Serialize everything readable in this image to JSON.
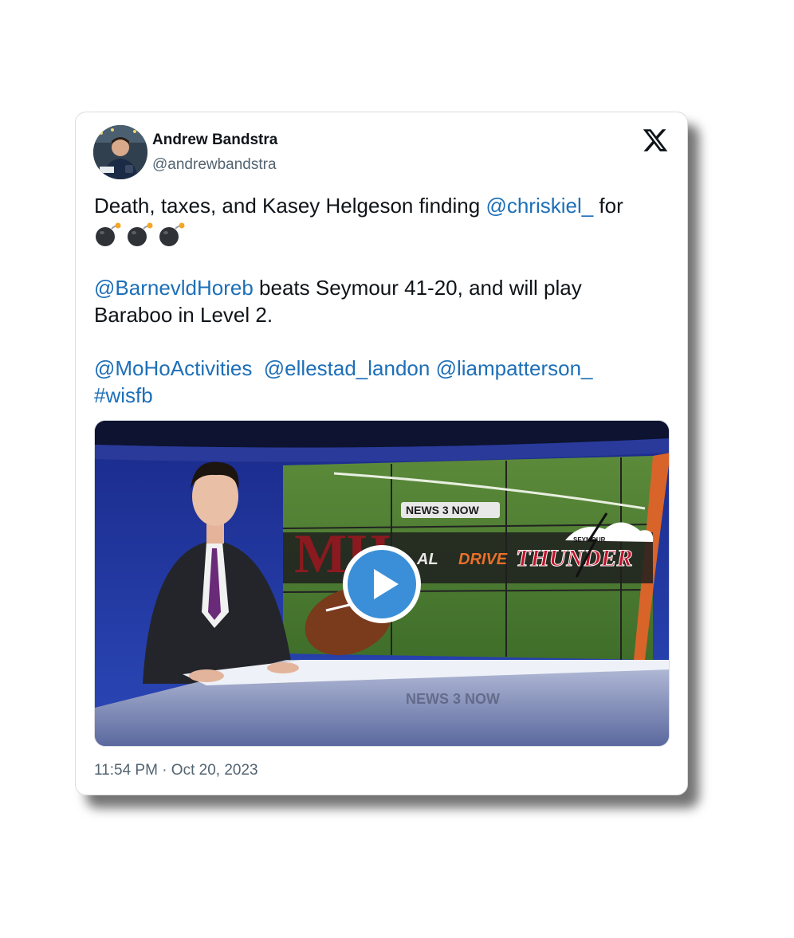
{
  "author": {
    "display_name": "Andrew Bandstra",
    "handle": "@andrewbandstra"
  },
  "icons": {
    "platform": "x-logo-icon",
    "play": "play-icon",
    "emoji": "bomb-emoji-icon"
  },
  "tweet": {
    "line1_text": "Death, taxes, and Kasey Helgeson finding ",
    "line1_mention": "@chriskiel_",
    "line1_after": " for",
    "emoji_count": 3,
    "para2_mention": "@BarnevldHoreb",
    "para2_text": " beats Seymour 41-20, and will play Baraboo in Level 2.",
    "para3_mentions": [
      "@MoHoActivities",
      "@ellestad_landon",
      "@liampatterson_"
    ],
    "para3_hashtag": "#wisfb"
  },
  "video": {
    "station_logo": "NEWS 3 NOW",
    "school_logo": "MH",
    "segment_left": "AL",
    "segment_right": "DRIVE",
    "opponent_small": "SEYMOUR",
    "opponent_logo": "THUNDER",
    "reflection_text": "NEWS 3 NOW"
  },
  "timestamp": "11:54 PM · Oct 20, 2023",
  "colors": {
    "link": "#1d6fb8",
    "text": "#0f1419",
    "secondary": "#536471",
    "play_button": "#3b8fd8",
    "school_maroon": "#8a1a1f",
    "thunder_red": "#c0142b"
  }
}
